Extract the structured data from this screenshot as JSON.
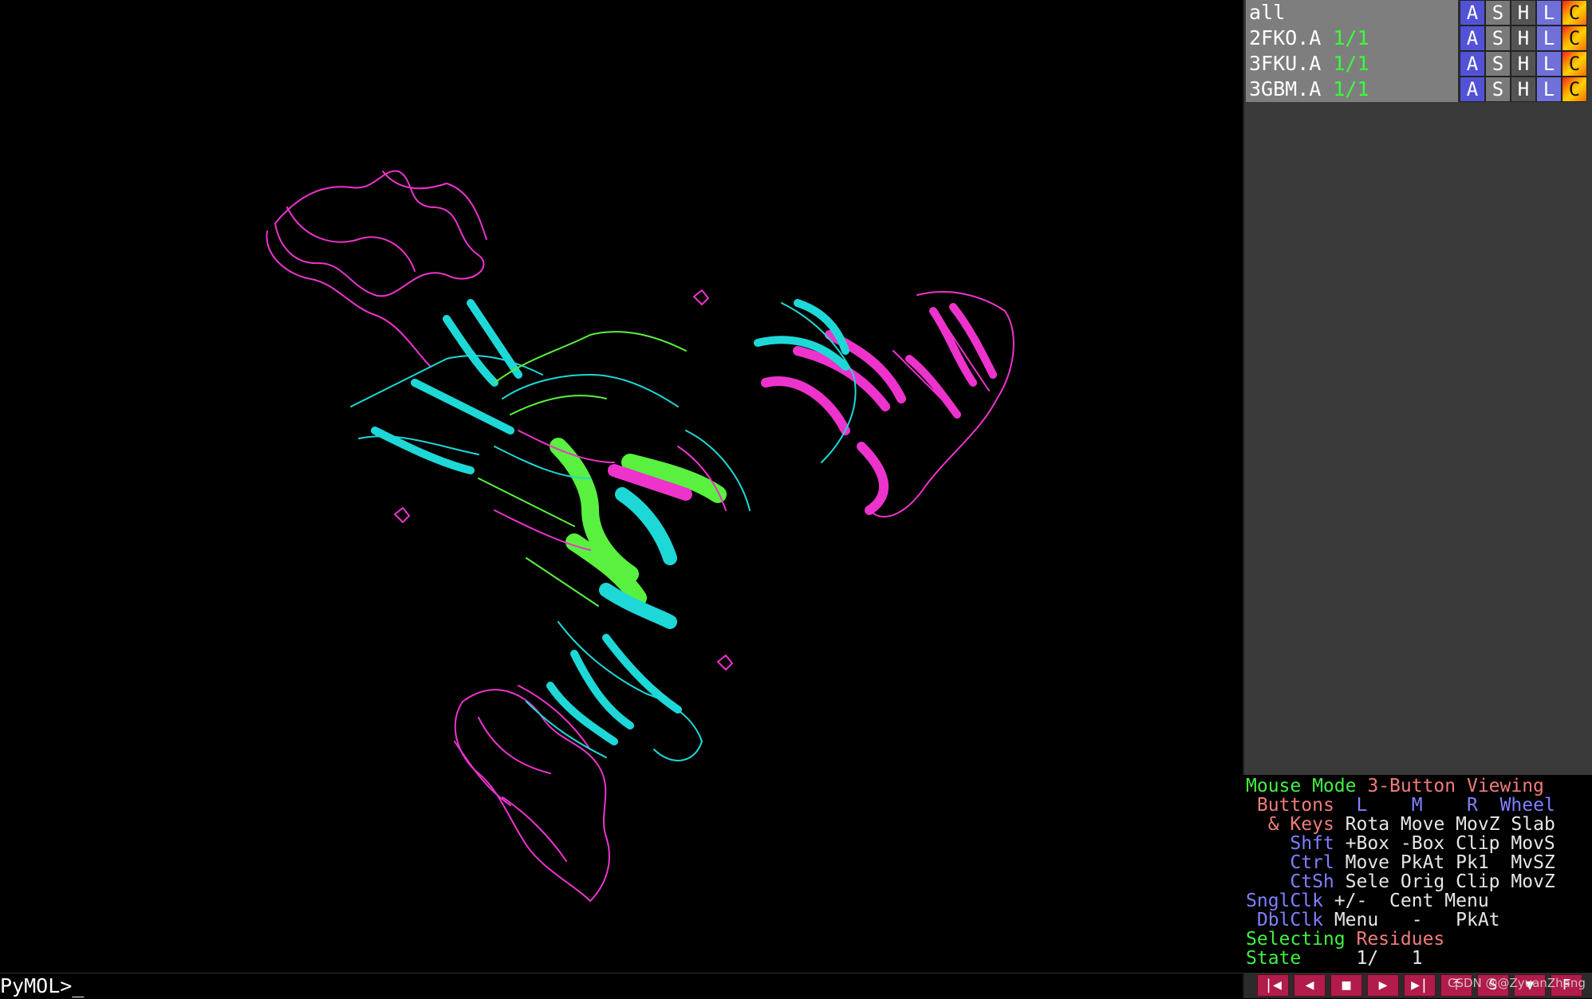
{
  "command_line": {
    "prompt": "PyMOL>",
    "cursor": "_"
  },
  "object_panel": {
    "rows": [
      {
        "name": "all",
        "state": "",
        "buttons": [
          "A",
          "S",
          "H",
          "L",
          "C"
        ]
      },
      {
        "name": "2FKO.A",
        "state": "1/1",
        "buttons": [
          "A",
          "S",
          "H",
          "L",
          "C"
        ]
      },
      {
        "name": "3FKU.A",
        "state": "1/1",
        "buttons": [
          "A",
          "S",
          "H",
          "L",
          "C"
        ]
      },
      {
        "name": "3GBM.A",
        "state": "1/1",
        "buttons": [
          "A",
          "S",
          "H",
          "L",
          "C"
        ]
      }
    ]
  },
  "mouse_info": {
    "mode_label": "Mouse Mode",
    "mode_value": "3-Button Viewing",
    "buttons_label": "Buttons",
    "col_l": "L",
    "col_m": "M",
    "col_r": "R",
    "col_wheel": "Wheel",
    "keys_label": "& Keys",
    "rows": [
      {
        "key": "",
        "l": "Rota",
        "m": "Move",
        "r": "MovZ",
        "w": "Slab"
      },
      {
        "key": "Shft",
        "l": "+Box",
        "m": "-Box",
        "r": "Clip",
        "w": "MovS"
      },
      {
        "key": "Ctrl",
        "l": "Move",
        "m": "PkAt",
        "r": "Pk1",
        "w": "MvSZ"
      },
      {
        "key": "CtSh",
        "l": "Sele",
        "m": "Orig",
        "r": "Clip",
        "w": "MovZ"
      },
      {
        "key": "SnglClk",
        "l": "+/-",
        "m": "Cent",
        "r": "Menu",
        "w": ""
      },
      {
        "key": "DblClk",
        "l": "Menu",
        "m": "-",
        "r": "PkAt",
        "w": ""
      }
    ],
    "selecting_label": "Selecting",
    "selecting_value": "Residues",
    "state_label": "State",
    "state_value": "1/",
    "state_total": "1"
  },
  "playback": {
    "buttons": [
      "|◀",
      "◀",
      "■",
      "▶",
      "▶|",
      "⤒",
      "S",
      "▼",
      "F"
    ]
  },
  "watermark": "CSDN @@ZyuanZhang",
  "colors": {
    "chain_magenta": "#ee33cc",
    "chain_cyan": "#1ed8d8",
    "chain_green": "#5af040",
    "background": "#000000"
  }
}
